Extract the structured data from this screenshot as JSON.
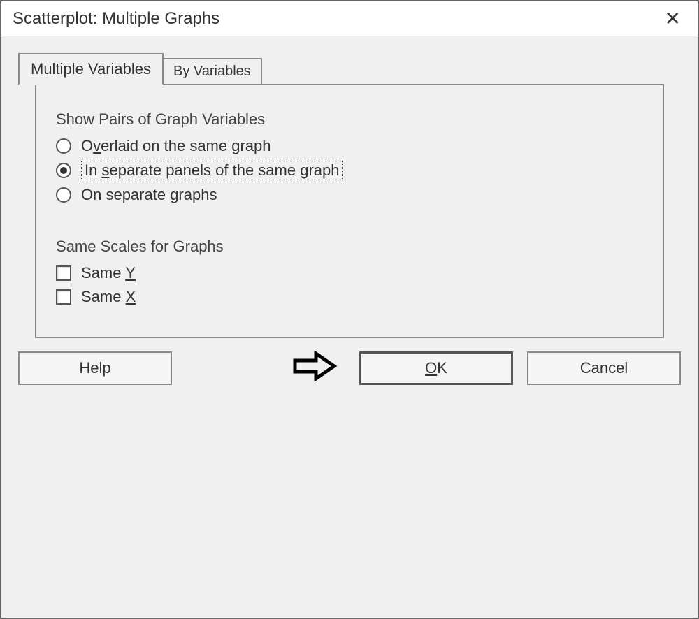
{
  "dialog": {
    "title": "Scatterplot: Multiple Graphs"
  },
  "tabs": {
    "active": "Multiple Variables",
    "inactive": "By Variables"
  },
  "group1": {
    "label": "Show Pairs of Graph Variables",
    "options": {
      "overlaid": "Overlaid on the same graph",
      "separate_panels": "In separate panels of the same graph",
      "separate_graphs": "On separate graphs"
    },
    "selected": "separate_panels"
  },
  "group2": {
    "label": "Same Scales for Graphs",
    "checkboxes": {
      "same_y": "Same Y",
      "same_x": "Same X"
    }
  },
  "buttons": {
    "help": "Help",
    "ok": "OK",
    "cancel": "Cancel"
  }
}
